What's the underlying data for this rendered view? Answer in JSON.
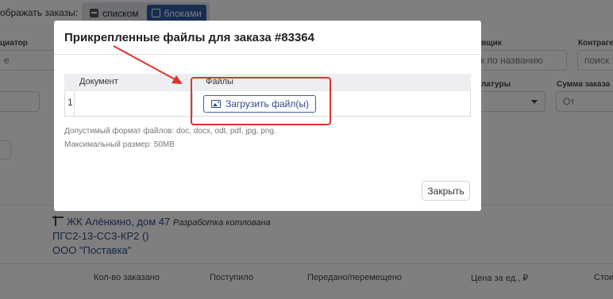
{
  "background": {
    "view_label": "ображать заказы:",
    "view_list": "списком",
    "view_blocks": "блоками",
    "labels": {
      "initiator": "циатор",
      "supplier": "вщик",
      "contragent": "Контраге",
      "nomenclature": "латуры",
      "order_sum": "Сумма заказа"
    },
    "inputs": {
      "initiator_value": "е",
      "supplier_placeholder": "ск по названию",
      "contragent_placeholder": "поиск",
      "order_sum_from": "От"
    },
    "object": {
      "name": "ЖК Алёнкино, дом 47",
      "stage": "Разработка котлована",
      "code": "ПГС2-13-СС3-КР2 ()",
      "company": "ООО \"Поставка\""
    },
    "columns": [
      "Кол-во заказано",
      "Поступило",
      "Передано/перемещено",
      "Цена за ед., ₽",
      "Стои"
    ]
  },
  "modal": {
    "title": "Прикрепленные файлы для заказа #83364",
    "table": {
      "headers": [
        "Документ",
        "Файлы"
      ],
      "rows": [
        {
          "num": "1",
          "document": ""
        }
      ]
    },
    "upload_label": "Загрузить файл(ы)",
    "hint_formats": "Допустимый формат файлов: doc, docx, odt, pdf, jpg, png.",
    "hint_size": "Максимальный размер: 50MB",
    "close_label": "Закрыть"
  },
  "colors": {
    "accent": "#2f5aa6",
    "link": "#2b4a8c",
    "annotation": "#e0332c"
  }
}
